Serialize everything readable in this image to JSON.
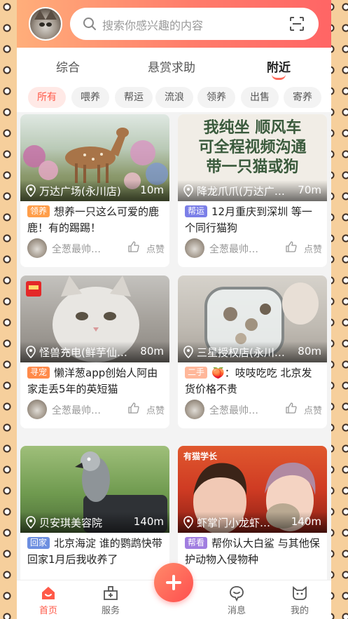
{
  "search": {
    "placeholder": "搜索你感兴趣的内容"
  },
  "tabs": [
    {
      "label": "综合",
      "active": false
    },
    {
      "label": "悬赏求助",
      "active": false
    },
    {
      "label": "附近",
      "active": true
    }
  ],
  "chips": [
    {
      "label": "所有",
      "active": true
    },
    {
      "label": "喂养",
      "active": false
    },
    {
      "label": "帮运",
      "active": false
    },
    {
      "label": "流浪",
      "active": false
    },
    {
      "label": "领养",
      "active": false
    },
    {
      "label": "出售",
      "active": false
    },
    {
      "label": "寄养",
      "active": false
    }
  ],
  "cards": [
    {
      "location": "万达广场(永川店)",
      "distance": "10m",
      "tag": "领养",
      "tag_color": "#ff9e4a",
      "title": "想养一只这么可爱的鹿鹿！有的踢踢！",
      "user": "全葱最帅…",
      "like": "点赞",
      "image_text": ""
    },
    {
      "location": "降龙爪爪(万达广…",
      "distance": "70m",
      "tag": "帮运",
      "tag_color": "#7b7fe8",
      "title": "12月重庆到深圳 等一个同行猫狗",
      "user": "全葱最帅…",
      "like": "点赞",
      "image_text": "我纯坐 顺风车\n可全程视频沟通\n带一只猫或狗"
    },
    {
      "location": "怪兽充电(鲜芋仙…",
      "distance": "80m",
      "tag": "寻宠",
      "tag_color": "#ff8a4a",
      "title": "懒洋葱app创始人阿由家走丢5年的英短猫",
      "user": "全葱最帅…",
      "like": "点赞",
      "image_text": ""
    },
    {
      "location": "三星授权店(永川…",
      "distance": "80m",
      "tag": "二手",
      "tag_color": "#ffb79a",
      "title": "🍑：吱吱吃吃 北京发货价格不贵",
      "user": "全葱最帅…",
      "like": "点赞",
      "image_text": ""
    },
    {
      "location": "贝安琪美容院",
      "distance": "140m",
      "tag": "回家",
      "tag_color": "#6d8fe0",
      "title": "北京海淀 谁的鹦鹉快带回家1月后我收养了",
      "user": "",
      "like": "",
      "image_text": ""
    },
    {
      "location": "虾掌门小龙虾…",
      "distance": "140m",
      "tag": "帮看",
      "tag_color": "#a07de0",
      "title": "帮你认大白鲨 与其他保护动物入侵物种",
      "user": "",
      "like": "",
      "image_text": "有猫学长"
    }
  ],
  "nav": [
    {
      "label": "首页",
      "icon": "home-icon",
      "active": true
    },
    {
      "label": "服务",
      "icon": "service-icon",
      "active": false
    },
    {
      "label": "消息",
      "icon": "message-icon",
      "active": false
    },
    {
      "label": "我的",
      "icon": "cat-face-icon",
      "active": false
    }
  ],
  "colors": {
    "accent": "#ff5a49",
    "header_start": "#ffae7a",
    "header_end": "#ff6565"
  }
}
